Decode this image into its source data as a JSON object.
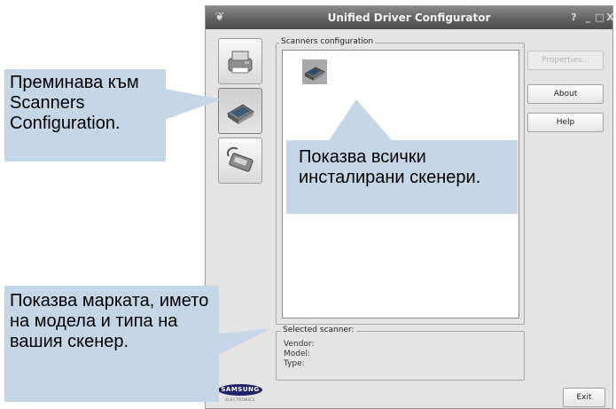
{
  "window": {
    "title": "Unified Driver Configurator",
    "controls": {
      "help": "?",
      "minimize": "_",
      "maximize": "□",
      "close": "X"
    }
  },
  "sidebar": {
    "items": [
      {
        "icon": "printer-icon",
        "active": false
      },
      {
        "icon": "scanner-icon",
        "active": true
      },
      {
        "icon": "port-icon",
        "active": false
      }
    ]
  },
  "scanners_config": {
    "label": "Scanners configuration",
    "items": [
      {
        "icon": "scanner-icon"
      }
    ]
  },
  "buttons": {
    "properties": "Properties...",
    "about": "About",
    "help": "Help",
    "exit": "Exit"
  },
  "selected_scanner": {
    "label": "Selected scanner:",
    "vendor": "Vendor:",
    "model": "Model:",
    "type": "Type:"
  },
  "logo": {
    "brand": "SAMSUNG",
    "sub": "ELECTRONICS"
  },
  "callouts": {
    "switch": "Преминава към Scanners Configuration.",
    "list": "Показва всички инсталирани скенери.",
    "info": "Показва марката, името на модела и типа на вашия скенер."
  },
  "colors": {
    "callout_bg": "#c5d7e6",
    "titlebar": "#5e5e5e"
  }
}
